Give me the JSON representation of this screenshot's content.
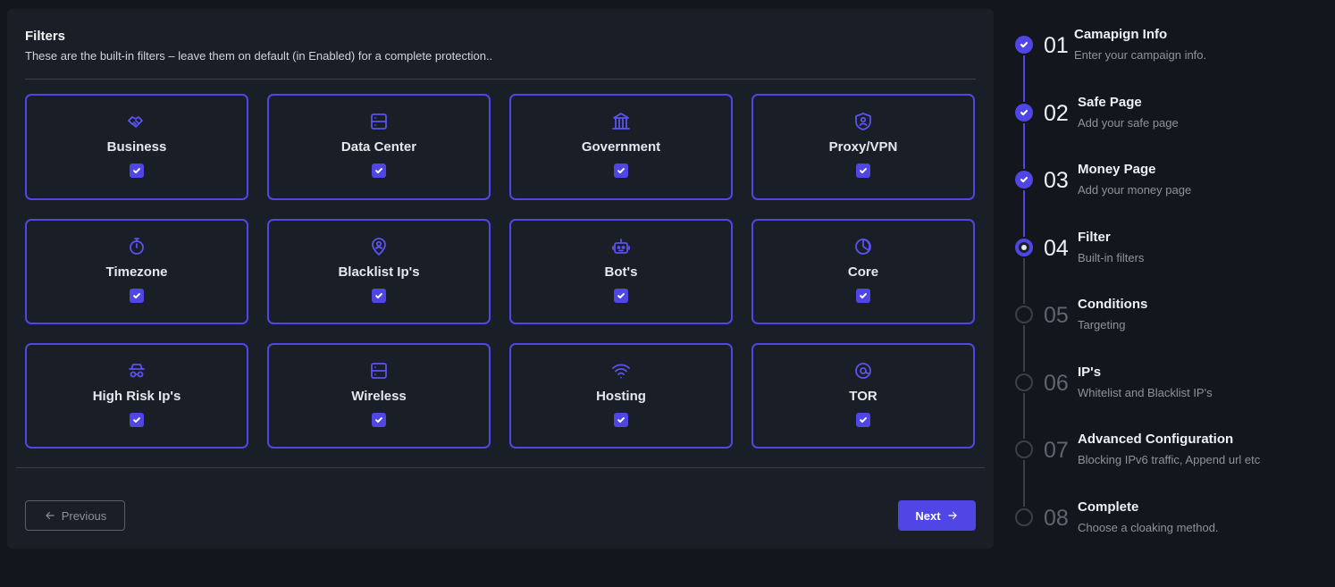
{
  "filters": {
    "title": "Filters",
    "subtitle": "These are the built-in filters – leave them on default (in Enabled) for a complete protection..",
    "items": [
      {
        "label": "Business",
        "icon": "handshake-icon",
        "checked": true
      },
      {
        "label": "Data Center",
        "icon": "server-icon",
        "checked": true
      },
      {
        "label": "Government",
        "icon": "building-columns-icon",
        "checked": true
      },
      {
        "label": "Proxy/VPN",
        "icon": "shield-user-icon",
        "checked": true
      },
      {
        "label": "Timezone",
        "icon": "stopwatch-icon",
        "checked": true
      },
      {
        "label": "Blacklist Ip's",
        "icon": "map-pin-user-icon",
        "checked": true
      },
      {
        "label": "Bot's",
        "icon": "robot-icon",
        "checked": true
      },
      {
        "label": "Core",
        "icon": "chart-pie-icon",
        "checked": true
      },
      {
        "label": "High Risk Ip's",
        "icon": "spy-incognito-icon",
        "checked": true
      },
      {
        "label": "Wireless",
        "icon": "server-icon",
        "checked": true
      },
      {
        "label": "Hosting",
        "icon": "wifi-icon",
        "checked": true
      },
      {
        "label": "TOR",
        "icon": "target-at-icon",
        "checked": true
      }
    ]
  },
  "nav": {
    "previous_label": "Previous",
    "next_label": "Next"
  },
  "colors": {
    "accent": "#4f46e5",
    "panel_bg": "#1a1f27",
    "page_bg": "#13171d"
  },
  "steps": [
    {
      "number": "01",
      "title": "Camapign Info",
      "description": "Enter your campaign info.",
      "state": "done"
    },
    {
      "number": "02",
      "title": "Safe Page",
      "description": "Add your safe page",
      "state": "done"
    },
    {
      "number": "03",
      "title": "Money Page",
      "description": "Add your money page",
      "state": "done"
    },
    {
      "number": "04",
      "title": "Filter",
      "description": "Built-in filters",
      "state": "current"
    },
    {
      "number": "05",
      "title": "Conditions",
      "description": "Targeting",
      "state": "todo"
    },
    {
      "number": "06",
      "title": "IP's",
      "description": "Whitelist and Blacklist IP's",
      "state": "todo"
    },
    {
      "number": "07",
      "title": "Advanced Configuration",
      "description": "Blocking IPv6 traffic, Append url etc",
      "state": "todo"
    },
    {
      "number": "08",
      "title": "Complete",
      "description": "Choose a cloaking method.",
      "state": "todo"
    }
  ]
}
